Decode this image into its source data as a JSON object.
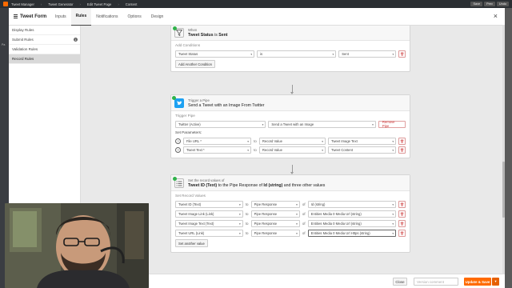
{
  "appbar": {
    "crumbs": [
      "Tweet Manager",
      "Tweet Generator",
      "Edit Tweet Page",
      "Content"
    ],
    "buttons": [
      "Save",
      "Prev",
      "Undo"
    ]
  },
  "rail": {
    "label": "Pa"
  },
  "modal": {
    "title": "Tweet Form",
    "tabs": [
      "Inputs",
      "Rules",
      "Notifications",
      "Options",
      "Design"
    ],
    "active_tab": "Rules",
    "close_label": "×"
  },
  "sidebar": {
    "items": [
      {
        "label": "Display Rules"
      },
      {
        "label": "Submit Rules",
        "badge": "1"
      },
      {
        "label": "Validation Rules"
      },
      {
        "label": "Record Rules"
      }
    ]
  },
  "when_card": {
    "small": "When",
    "field": "Tweet Status",
    "is_word": "is",
    "value": "Sent",
    "section_label": "Add Conditions",
    "cond_field": "Tweet Status",
    "cond_op": "is",
    "cond_value": "Sent",
    "add_button": "Add Another Condition"
  },
  "pipe_card": {
    "small": "Trigger a Pipe",
    "main": "Send a Tweet with an Image From Twitter",
    "section_label": "Trigger Pipe",
    "account": "Twitter (Active)",
    "pipe": "Send a Tweet with an Image",
    "remove_button": "Remove Pipe",
    "params_label": "Set Parameters:",
    "params": [
      {
        "field": "File URL *",
        "to": "to",
        "source": "Record Value",
        "value": "Tweet Image Text"
      },
      {
        "field": "Tweet Text *",
        "to": "to",
        "source": "Record Value",
        "value": "Tweet Content"
      }
    ]
  },
  "record_card": {
    "small": "Set the record values of",
    "main_a": "Tweet ID (Text)",
    "main_b": " to the Pipe Response of ",
    "main_c": "Id (string)",
    "main_d": " and three other values",
    "section_label": "Set Record Values",
    "rows": [
      {
        "field": "Tweet ID (Text)",
        "to": "to",
        "source": "Pipe Response",
        "of": "of",
        "value": "Id (string)"
      },
      {
        "field": "Tweet Image Link (Link)",
        "to": "to",
        "source": "Pipe Response",
        "of": "of",
        "value": "Entities Media 0 Media Url (string)"
      },
      {
        "field": "Tweet Image Text (Text)",
        "to": "to",
        "source": "Pipe Response",
        "of": "of",
        "value": "Entities Media 0 Media Url (string)"
      },
      {
        "field": "Tweet URL (Link)",
        "to": "to",
        "source": "Pipe Response",
        "of": "of",
        "value": "Entities Media 0 Media Url Https (string)"
      }
    ],
    "add_button": "Set another value"
  },
  "footer": {
    "close": "Close",
    "version_placeholder": "Version comment",
    "save": "Update & Save",
    "save_caret": "▾"
  },
  "colors": {
    "brand_orange": "#ff6a00",
    "twitter_blue": "#1da1f2",
    "success_green": "#2fb24a",
    "danger_red": "#cc3333"
  }
}
